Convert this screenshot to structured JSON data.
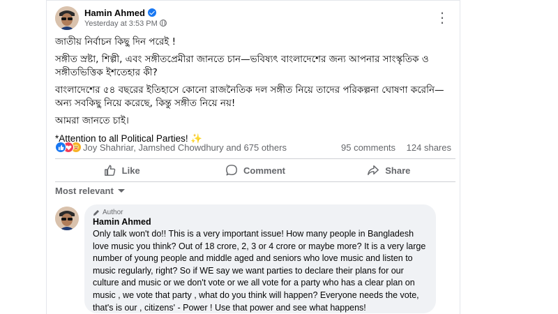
{
  "post": {
    "author_name": "Hamin Ahmed",
    "timestamp": "Yesterday at 3:53 PM",
    "more_options": "⋮",
    "paragraphs": [
      "জাতীয় নির্বাচন কিছু দিন পরেই !",
      "সঙ্গীত স্রষ্টা, শিল্পী, এবং সঙ্গীতপ্রেমীরা জানতে চান—ভবিষ্যৎ বাংলাদেশের জন্য আপনার সাংস্কৃতিক ও সঙ্গীতভিত্তিক ইশতেহার কী?",
      "বাংলাদেশের ৫৪ বছরের ইতিহাসে কোনো রাজনৈতিক দল সঙ্গীত নিয়ে তাদের পরিকল্পনা ঘোষণা করেনি— অন্য সবকিছু নিয়ে করেছে, কিন্তু সঙ্গীত নিয়ে নয়!",
      "আমরা জানতে চাই।",
      "*Attention to all Political Parties! ✨"
    ]
  },
  "reactions": {
    "icons": [
      "like-icon",
      "love-icon",
      "care-icon"
    ],
    "reactors": "Joy Shahriar, Jamshed Chowdhury and 675 others",
    "comments": "95 comments",
    "shares": "124 shares"
  },
  "actions": {
    "like": "Like",
    "comment": "Comment",
    "share": "Share"
  },
  "comments_section": {
    "sort_label": "Most relevant"
  },
  "comment": {
    "badge": "Author",
    "author_name": "Hamin Ahmed",
    "text": "Only talk won't do!! This is a very important issue! How many people in Bangladesh love music you think? Out of 18 crore, 2, 3 or 4 crore or maybe more? It is a very large number of young people and middle aged and seniors who love music and listen to music regularly, right? So if WE say we want parties to declare their plans for our culture and music or we don't vote or we all vote for a party who has a clear plan on music , we vote that party , what do you think will happen? Everyone needs the vote, that's is our , citizens' - Power ! Use that power and see what happens!"
  },
  "colors": {
    "accent": "#1877f2",
    "love": "#f33e58",
    "care": "#f7b125",
    "secondary_text": "#65676b",
    "bubble_bg": "#f0f2f5"
  }
}
